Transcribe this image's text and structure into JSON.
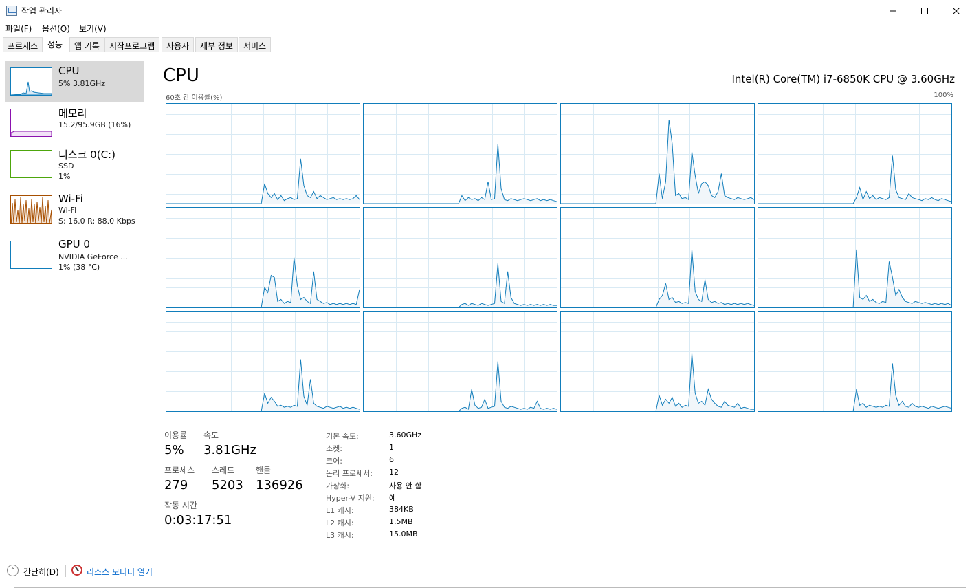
{
  "window": {
    "title": "작업 관리자"
  },
  "menu": [
    "파일(F)",
    "옵션(O)",
    "보기(V)"
  ],
  "tabs": [
    "프로세스",
    "성능",
    "앱 기록",
    "시작프로그램",
    "사용자",
    "세부 정보",
    "서비스"
  ],
  "active_tab": "성능",
  "sidebar": {
    "items": [
      {
        "title": "CPU",
        "sub1": "5% 3.81GHz",
        "sub2": "",
        "sub3": "",
        "color": "#117dbb"
      },
      {
        "title": "메모리",
        "sub1": "15.2/95.9GB (16%)",
        "sub2": "",
        "sub3": "",
        "color": "#8b12ae"
      },
      {
        "title": "디스크 0(C:)",
        "sub1": "SSD",
        "sub2": "1%",
        "sub3": "",
        "color": "#4da60c"
      },
      {
        "title": "Wi-Fi",
        "sub1": "Wi-Fi",
        "sub2": "S: 16.0 R: 88.0 Kbps",
        "sub3": "",
        "color": "#a74f01"
      },
      {
        "title": "GPU 0",
        "sub1": "NVIDIA GeForce ...",
        "sub2": "1% (38 °C)",
        "sub3": "",
        "color": "#117dbb"
      }
    ]
  },
  "main": {
    "title": "CPU",
    "model": "Intel(R) Core(TM) i7-6850K CPU @ 3.60GHz",
    "graph_left_label": "60초 간 이용률(%)",
    "graph_right_label": "100%",
    "accent_color": "#117dbb"
  },
  "chart_data": {
    "type": "line",
    "x": [
      0,
      1,
      2,
      3,
      4,
      5,
      6,
      7,
      8,
      9,
      10,
      11,
      12,
      13,
      14,
      15,
      16,
      17,
      18,
      19,
      20,
      21,
      22,
      23,
      24,
      25,
      26,
      27,
      28,
      29,
      30,
      31,
      32,
      33,
      34,
      35,
      36,
      37,
      38,
      39,
      40,
      41,
      42,
      43,
      44,
      45,
      46,
      47,
      48,
      49,
      50,
      51,
      52,
      53,
      54,
      55,
      56,
      57,
      58,
      59
    ],
    "ylim": [
      0,
      100
    ],
    "series": [
      {
        "values": [
          0,
          0,
          0,
          0,
          0,
          0,
          0,
          0,
          0,
          0,
          0,
          0,
          0,
          0,
          0,
          0,
          0,
          0,
          0,
          0,
          0,
          0,
          0,
          0,
          0,
          0,
          0,
          0,
          0,
          0,
          20,
          10,
          6,
          10,
          4,
          8,
          3,
          5,
          6,
          4,
          5,
          45,
          18,
          8,
          6,
          12,
          5,
          8,
          6,
          4,
          5,
          6,
          4,
          5,
          4,
          5,
          4,
          5,
          8,
          4
        ]
      },
      {
        "values": [
          0,
          0,
          0,
          0,
          0,
          0,
          0,
          0,
          0,
          0,
          0,
          0,
          0,
          0,
          0,
          0,
          0,
          0,
          0,
          0,
          0,
          0,
          0,
          0,
          0,
          0,
          0,
          0,
          0,
          0,
          8,
          3,
          6,
          4,
          5,
          3,
          6,
          4,
          22,
          4,
          5,
          60,
          15,
          4,
          3,
          5,
          4,
          3,
          4,
          5,
          4,
          3,
          4,
          5,
          3,
          4,
          3,
          4,
          3,
          2
        ]
      },
      {
        "values": [
          0,
          0,
          0,
          0,
          0,
          0,
          0,
          0,
          0,
          0,
          0,
          0,
          0,
          0,
          0,
          0,
          0,
          0,
          0,
          0,
          0,
          0,
          0,
          0,
          0,
          0,
          0,
          0,
          0,
          0,
          30,
          5,
          22,
          84,
          60,
          8,
          10,
          5,
          6,
          4,
          52,
          28,
          10,
          20,
          22,
          18,
          8,
          6,
          12,
          30,
          8,
          6,
          5,
          4,
          6,
          5,
          4,
          5,
          6,
          4
        ]
      },
      {
        "values": [
          0,
          0,
          0,
          0,
          0,
          0,
          0,
          0,
          0,
          0,
          0,
          0,
          0,
          0,
          0,
          0,
          0,
          0,
          0,
          0,
          0,
          0,
          0,
          0,
          0,
          0,
          0,
          0,
          0,
          0,
          6,
          16,
          4,
          12,
          5,
          8,
          4,
          6,
          5,
          4,
          6,
          48,
          14,
          6,
          5,
          4,
          10,
          6,
          5,
          4,
          3,
          5,
          4,
          6,
          4,
          3,
          5,
          4,
          3,
          2
        ]
      },
      {
        "values": [
          0,
          0,
          0,
          0,
          0,
          0,
          0,
          0,
          0,
          0,
          0,
          0,
          0,
          0,
          0,
          0,
          0,
          0,
          0,
          0,
          0,
          0,
          0,
          0,
          0,
          0,
          0,
          0,
          0,
          0,
          20,
          15,
          32,
          30,
          6,
          8,
          4,
          6,
          5,
          50,
          22,
          8,
          10,
          6,
          4,
          36,
          8,
          6,
          4,
          5,
          3,
          4,
          3,
          4,
          3,
          4,
          3,
          4,
          3,
          18
        ]
      },
      {
        "values": [
          0,
          0,
          0,
          0,
          0,
          0,
          0,
          0,
          0,
          0,
          0,
          0,
          0,
          0,
          0,
          0,
          0,
          0,
          0,
          0,
          0,
          0,
          0,
          0,
          0,
          0,
          0,
          0,
          0,
          0,
          3,
          4,
          2,
          4,
          3,
          2,
          4,
          3,
          2,
          3,
          4,
          44,
          6,
          4,
          36,
          10,
          4,
          3,
          2,
          3,
          2,
          3,
          2,
          3,
          2,
          3,
          2,
          3,
          2,
          2
        ]
      },
      {
        "values": [
          0,
          0,
          0,
          0,
          0,
          0,
          0,
          0,
          0,
          0,
          0,
          0,
          0,
          0,
          0,
          0,
          0,
          0,
          0,
          0,
          0,
          0,
          0,
          0,
          0,
          0,
          0,
          0,
          0,
          0,
          8,
          12,
          24,
          8,
          10,
          5,
          6,
          4,
          5,
          4,
          58,
          16,
          8,
          6,
          28,
          8,
          5,
          6,
          4,
          5,
          3,
          4,
          3,
          4,
          3,
          4,
          3,
          4,
          3,
          2
        ]
      },
      {
        "values": [
          0,
          0,
          0,
          0,
          0,
          0,
          0,
          0,
          0,
          0,
          0,
          0,
          0,
          0,
          0,
          0,
          0,
          0,
          0,
          0,
          0,
          0,
          0,
          0,
          0,
          0,
          0,
          0,
          0,
          0,
          58,
          10,
          8,
          12,
          6,
          8,
          5,
          4,
          6,
          5,
          46,
          30,
          12,
          18,
          10,
          6,
          5,
          4,
          6,
          5,
          4,
          5,
          4,
          3,
          4,
          3,
          4,
          3,
          4,
          2
        ]
      },
      {
        "values": [
          0,
          0,
          0,
          0,
          0,
          0,
          0,
          0,
          0,
          0,
          0,
          0,
          0,
          0,
          0,
          0,
          0,
          0,
          0,
          0,
          0,
          0,
          0,
          0,
          0,
          0,
          0,
          0,
          0,
          0,
          18,
          8,
          14,
          10,
          5,
          6,
          4,
          5,
          4,
          6,
          5,
          52,
          15,
          6,
          32,
          8,
          5,
          4,
          3,
          5,
          4,
          3,
          4,
          5,
          3,
          4,
          3,
          4,
          3,
          2
        ]
      },
      {
        "values": [
          0,
          0,
          0,
          0,
          0,
          0,
          0,
          0,
          0,
          0,
          0,
          0,
          0,
          0,
          0,
          0,
          0,
          0,
          0,
          0,
          0,
          0,
          0,
          0,
          0,
          0,
          0,
          0,
          0,
          0,
          3,
          4,
          2,
          22,
          6,
          3,
          4,
          12,
          3,
          4,
          5,
          50,
          10,
          4,
          3,
          5,
          4,
          3,
          2,
          3,
          2,
          4,
          3,
          10,
          3,
          2,
          3,
          2,
          3,
          2
        ]
      },
      {
        "values": [
          0,
          0,
          0,
          0,
          0,
          0,
          0,
          0,
          0,
          0,
          0,
          0,
          0,
          0,
          0,
          0,
          0,
          0,
          0,
          0,
          0,
          0,
          0,
          0,
          0,
          0,
          0,
          0,
          0,
          0,
          16,
          6,
          12,
          8,
          14,
          5,
          8,
          4,
          6,
          5,
          58,
          18,
          8,
          10,
          6,
          22,
          12,
          8,
          5,
          4,
          10,
          6,
          5,
          4,
          8,
          3,
          4,
          3,
          2,
          2
        ]
      },
      {
        "values": [
          0,
          0,
          0,
          0,
          0,
          0,
          0,
          0,
          0,
          0,
          0,
          0,
          0,
          0,
          0,
          0,
          0,
          0,
          0,
          0,
          0,
          0,
          0,
          0,
          0,
          0,
          0,
          0,
          0,
          0,
          22,
          6,
          8,
          4,
          6,
          5,
          4,
          5,
          4,
          6,
          5,
          48,
          16,
          6,
          10,
          5,
          4,
          8,
          5,
          4,
          5,
          4,
          3,
          5,
          4,
          3,
          4,
          5,
          4,
          3
        ]
      }
    ]
  },
  "stats": {
    "utilization_label": "이용률",
    "utilization_value": "5%",
    "speed_label": "속도",
    "speed_value": "3.81GHz",
    "processes_label": "프로세스",
    "processes_value": "279",
    "threads_label": "스레드",
    "threads_value": "5203",
    "handles_label": "핸들",
    "handles_value": "136926",
    "uptime_label": "작동 시간",
    "uptime_value": "0:03:17:51"
  },
  "specs": [
    {
      "label": "기본 속도:",
      "value": "3.60GHz"
    },
    {
      "label": "소켓:",
      "value": "1"
    },
    {
      "label": "코어:",
      "value": "6"
    },
    {
      "label": "논리 프로세서:",
      "value": "12"
    },
    {
      "label": "가상화:",
      "value": "사용 안 함"
    },
    {
      "label": "Hyper-V 지원:",
      "value": "예"
    },
    {
      "label": "L1 캐시:",
      "value": "384KB"
    },
    {
      "label": "L2 캐시:",
      "value": "1.5MB"
    },
    {
      "label": "L3 캐시:",
      "value": "15.0MB"
    }
  ],
  "footer": {
    "less_label": "간단히(D)",
    "resource_monitor_label": "리소스 모니터 열기"
  }
}
